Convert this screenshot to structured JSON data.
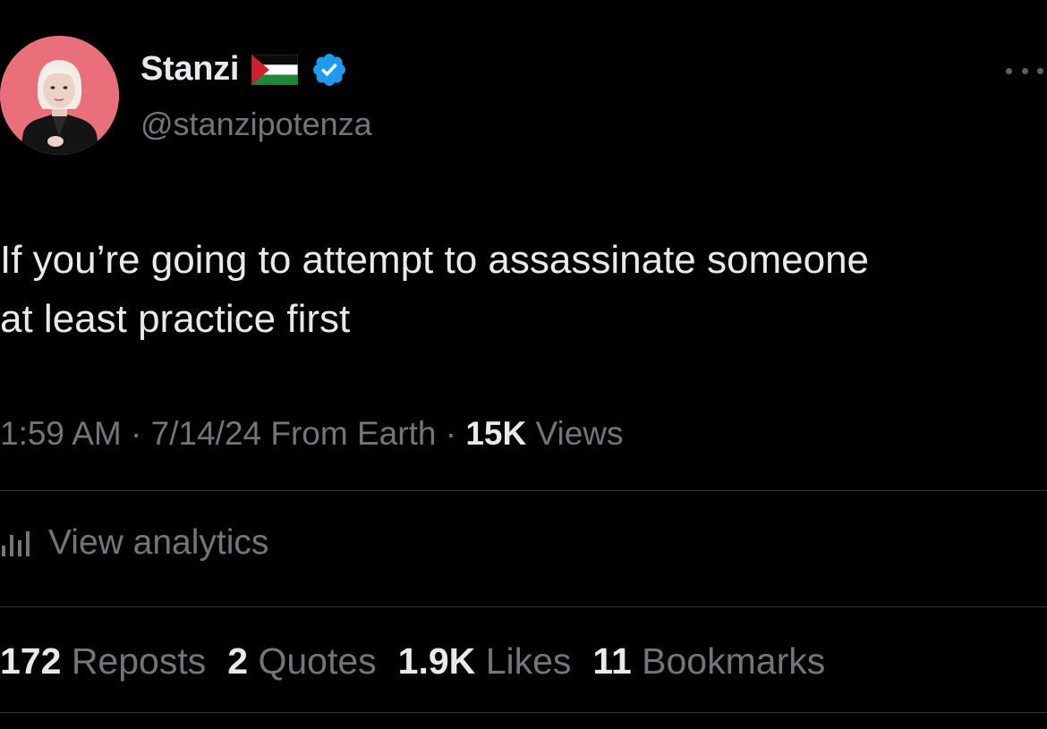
{
  "author": {
    "display_name": "Stanzi",
    "handle": "@stanzipotenza",
    "verified": true,
    "name_emoji": "palestine-flag-icon",
    "avatar_bg": "#e96f7b"
  },
  "tweet": {
    "text": "If you’re going to attempt to assassinate someone\nat least practice first"
  },
  "meta": {
    "time": "1:59 AM",
    "sep1": " · ",
    "date": "7/14/24",
    "source": " From Earth",
    "sep2": " · ",
    "views_count": "15K",
    "views_label": " Views"
  },
  "analytics": {
    "label": "View analytics"
  },
  "stats": [
    {
      "count": "172",
      "label": "Reposts"
    },
    {
      "count": "2",
      "label": "Quotes"
    },
    {
      "count": "1.9K",
      "label": "Likes"
    },
    {
      "count": "11",
      "label": "Bookmarks"
    }
  ],
  "colors": {
    "background": "#000000",
    "text": "#e7e9ea",
    "muted": "#71767b",
    "divider": "#2f3336",
    "verified_blue": "#1d9bf0"
  }
}
